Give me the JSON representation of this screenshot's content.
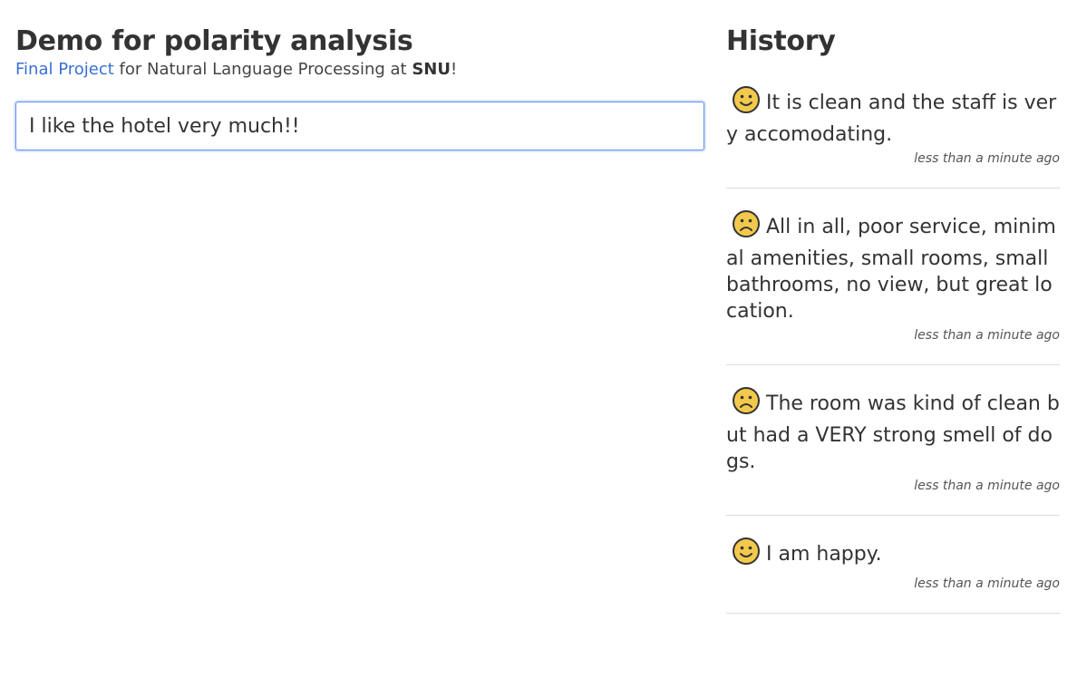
{
  "left": {
    "title": "Demo for polarity analysis",
    "subtitle_link": "Final Project",
    "subtitle_middle": " for Natural Language Processing at ",
    "subtitle_bold": "SNU",
    "subtitle_end": "!",
    "input_value": "I like the hotel very much!!"
  },
  "history": {
    "title": "History",
    "items": [
      {
        "sentiment": "happy-face-icon",
        "text": "It is clean and the staff is very accomodating.",
        "time": "less than a minute ago"
      },
      {
        "sentiment": "sad-face-icon",
        "text": "All in all, poor service, minimal amenities, small rooms, small bathrooms, no view, but great location.",
        "time": "less than a minute ago"
      },
      {
        "sentiment": "sad-face-icon",
        "text": "The room was kind of clean but had a VERY strong smell of dogs.",
        "time": "less than a minute ago"
      },
      {
        "sentiment": "happy-face-icon",
        "text": "I am happy.",
        "time": "less than a minute ago"
      }
    ]
  },
  "colors": {
    "link": "#3a6fd8",
    "face_fill": "#f2c94c",
    "face_stroke": "#333333",
    "divider": "#dddddd"
  }
}
